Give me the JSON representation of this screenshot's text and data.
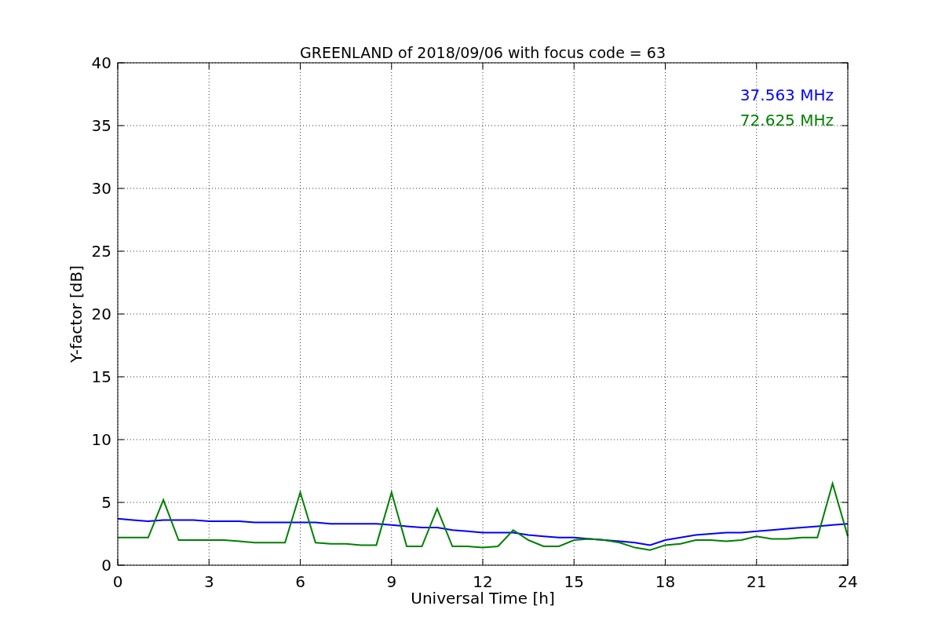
{
  "figure": {
    "chart_data": {
      "type": "line",
      "title": "GREENLAND of 2018/09/06 with focus code = 63",
      "xlabel": "Universal Time [h]",
      "ylabel": "Y-factor [dB]",
      "x": [
        0,
        0.5,
        1,
        1.5,
        2,
        2.5,
        3,
        3.5,
        4,
        4.5,
        5,
        5.5,
        6,
        6.5,
        7,
        7.5,
        8,
        8.5,
        9,
        9.5,
        10,
        10.5,
        11,
        11.5,
        12,
        12.5,
        13,
        13.5,
        14,
        14.5,
        15,
        15.5,
        16,
        16.5,
        17,
        17.5,
        18,
        18.5,
        19,
        19.5,
        20,
        20.5,
        21,
        21.5,
        22,
        22.5,
        23,
        23.5,
        24
      ],
      "series": [
        {
          "name": "37.563 MHz",
          "color": "#0000ff",
          "values": [
            3.7,
            3.6,
            3.5,
            3.6,
            3.6,
            3.6,
            3.5,
            3.5,
            3.5,
            3.4,
            3.4,
            3.4,
            3.4,
            3.4,
            3.3,
            3.3,
            3.3,
            3.3,
            3.2,
            3.1,
            3.0,
            3.0,
            2.8,
            2.7,
            2.6,
            2.6,
            2.6,
            2.4,
            2.3,
            2.2,
            2.2,
            2.1,
            2.0,
            1.9,
            1.8,
            1.6,
            2.0,
            2.2,
            2.4,
            2.5,
            2.6,
            2.6,
            2.7,
            2.8,
            2.9,
            3.0,
            3.1,
            3.2,
            3.3
          ]
        },
        {
          "name": "72.625 MHz",
          "color": "#008000",
          "values": [
            2.2,
            2.2,
            2.2,
            5.2,
            2.0,
            2.0,
            2.0,
            2.0,
            1.9,
            1.8,
            1.8,
            1.8,
            5.8,
            1.8,
            1.7,
            1.7,
            1.6,
            1.6,
            5.8,
            1.5,
            1.5,
            4.5,
            1.5,
            1.5,
            1.4,
            1.5,
            2.8,
            2.0,
            1.5,
            1.5,
            2.0,
            2.1,
            2.0,
            1.8,
            1.4,
            1.2,
            1.6,
            1.7,
            2.0,
            2.0,
            1.9,
            2.0,
            2.3,
            2.1,
            2.1,
            2.2,
            2.2,
            6.5,
            2.3
          ]
        }
      ],
      "grid": true,
      "xlim": [
        0,
        24
      ],
      "ylim": [
        0,
        40
      ],
      "xticks": [
        0,
        3,
        6,
        9,
        12,
        15,
        18,
        21,
        24
      ],
      "yticks": [
        0,
        5,
        10,
        15,
        20,
        25,
        30,
        35,
        40
      ]
    }
  }
}
